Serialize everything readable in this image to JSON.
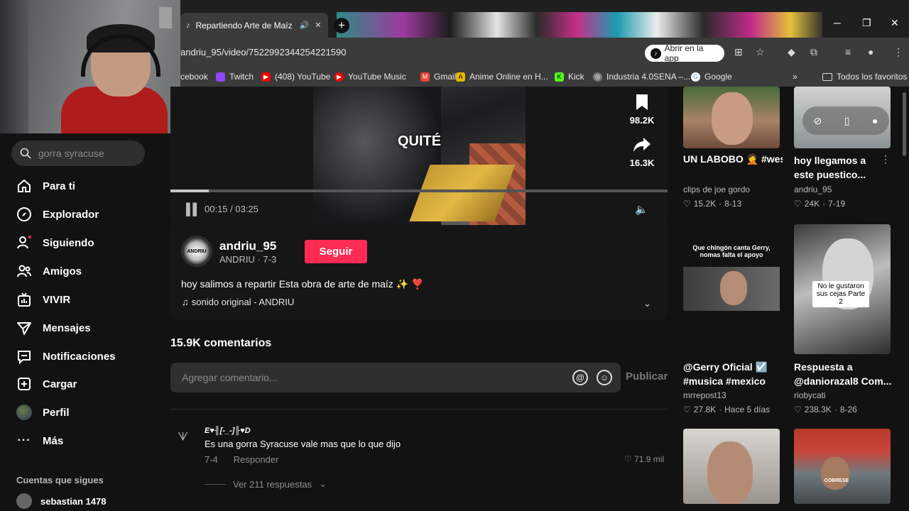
{
  "browser": {
    "tab_title": "Repartiendo Arte de Maíz e",
    "new_tab": "+",
    "url": "andriu_95/video/7522992344254221590",
    "open_app": "Abrir en la app",
    "bookmarks": [
      {
        "label": "cebook",
        "color": "#1877f2"
      },
      {
        "label": "Twitch",
        "color": "#9146ff"
      },
      {
        "label": "(408) YouTube",
        "color": "#ff0000"
      },
      {
        "label": "YouTube Music",
        "color": "#ff0000"
      },
      {
        "label": "Gmail",
        "color": "#ea4335"
      },
      {
        "label": "Anime Online en H...",
        "color": "#e6b800"
      },
      {
        "label": "Kick",
        "color": "#53fc18"
      },
      {
        "label": "Industria 4.0SENA –...",
        "color": "#888888"
      },
      {
        "label": "Google",
        "color": "#4285f4"
      }
    ],
    "bookmarks_more": "»",
    "all_bookmarks": "Todos los favoritos"
  },
  "sidebar": {
    "search_placeholder": "gorra syracuse",
    "items": [
      {
        "label": "Para ti",
        "icon": "home-icon"
      },
      {
        "label": "Explorador",
        "icon": "compass-icon"
      },
      {
        "label": "Siguiendo",
        "icon": "following-icon"
      },
      {
        "label": "Amigos",
        "icon": "friends-icon"
      },
      {
        "label": "VIVIR",
        "icon": "live-icon"
      },
      {
        "label": "Mensajes",
        "icon": "messages-icon"
      },
      {
        "label": "Notificaciones",
        "icon": "notifications-icon"
      },
      {
        "label": "Cargar",
        "icon": "upload-icon"
      },
      {
        "label": "Perfil",
        "icon": "profile-icon"
      },
      {
        "label": "Más",
        "icon": "more-icon"
      }
    ],
    "following_header": "Cuentas que sigues",
    "following_first": "sebastian 1478"
  },
  "video": {
    "caption": "QUITÉ",
    "time": "00:15 / 03:25",
    "progress": 0.077,
    "save_count": "98.2K",
    "share_count": "16.3K",
    "author": "andriu_95",
    "author_sub": "ANDRIU · 7-3",
    "avatar_text": "ANDRIU",
    "follow": "Seguir",
    "description": "hoy salimos a repartir Esta obra de arte de maíz ✨ ❣️",
    "sound": "sonido original - ANDRIU"
  },
  "comments": {
    "title": "15.9K comentarios",
    "placeholder": "Agregar comentario...",
    "publish": "Publicar",
    "first": {
      "user": "E♥╢[-_-]╟♥D",
      "text": "Es una gorra Syracuse vale mas que lo que dijo",
      "date": "7-4",
      "reply": "Responder",
      "likes": "71.9 mil",
      "view_replies": "Ver 211 respuestas"
    }
  },
  "related": [
    {
      "title": "UN LABOBO 🤦 #westcol #elchant...",
      "author": "clips de joe gordo",
      "likes": "15.2K",
      "date": "8-13"
    },
    {
      "title": "hoy llegamos a este puestico...",
      "author": "andriu_95",
      "likes": "24K",
      "date": "7-19"
    },
    {
      "title": "@Gerry Oficial ☑️ #musica #mexico",
      "author": "mrrepost13",
      "likes": "27.8K",
      "date": "Hace 5 días",
      "overlay": "Que chingón canta Gerry, nomas falta el apoyo"
    },
    {
      "title": "Respuesta a @daniorazal8 Com...",
      "author": "riobycati",
      "likes": "238.3K",
      "date": "8-26",
      "overlay": "No le gustaron sus cejas Parte 2"
    }
  ],
  "related_thumb5_overlay": "COBRESE"
}
